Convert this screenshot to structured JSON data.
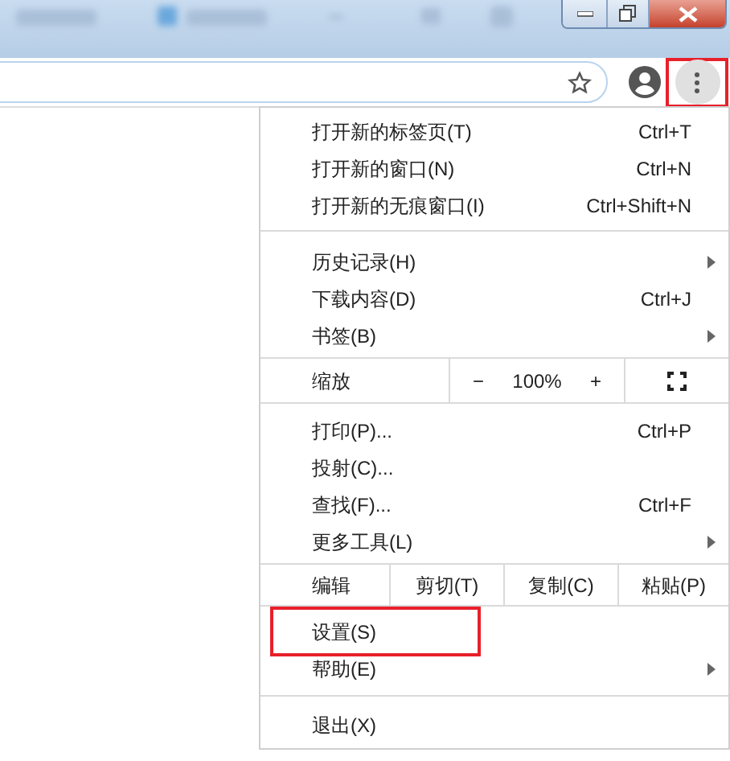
{
  "toolbar": {
    "menu_button_highlighted": true
  },
  "menu": {
    "sections": [
      {
        "items": [
          {
            "kind": "command",
            "label": "打开新的标签页(T)",
            "shortcut": "Ctrl+T",
            "submenu": false,
            "highlighted": false
          },
          {
            "kind": "command",
            "label": "打开新的窗口(N)",
            "shortcut": "Ctrl+N",
            "submenu": false,
            "highlighted": false
          },
          {
            "kind": "command",
            "label": "打开新的无痕窗口(I)",
            "shortcut": "Ctrl+Shift+N",
            "submenu": false,
            "highlighted": false
          }
        ]
      },
      {
        "items": [
          {
            "kind": "command",
            "label": "历史记录(H)",
            "submenu": true,
            "highlighted": false
          },
          {
            "kind": "command",
            "label": "下载内容(D)",
            "shortcut": "Ctrl+J",
            "submenu": false,
            "highlighted": false
          },
          {
            "kind": "command",
            "label": "书签(B)",
            "submenu": true,
            "highlighted": false
          }
        ]
      },
      {
        "items": [
          {
            "kind": "zoom",
            "label": "缩放",
            "minus": "−",
            "value": "100%",
            "plus": "+"
          }
        ]
      },
      {
        "items": [
          {
            "kind": "command",
            "label": "打印(P)...",
            "shortcut": "Ctrl+P",
            "submenu": false,
            "highlighted": false
          },
          {
            "kind": "command",
            "label": "投射(C)...",
            "submenu": false,
            "highlighted": false
          },
          {
            "kind": "command",
            "label": "查找(F)...",
            "shortcut": "Ctrl+F",
            "submenu": false,
            "highlighted": false
          },
          {
            "kind": "command",
            "label": "更多工具(L)",
            "submenu": true,
            "highlighted": false
          }
        ]
      },
      {
        "items": [
          {
            "kind": "edit",
            "label": "编辑",
            "cut": "剪切(T)",
            "copy": "复制(C)",
            "paste": "粘贴(P)"
          }
        ]
      },
      {
        "items": [
          {
            "kind": "command",
            "label": "设置(S)",
            "submenu": false,
            "highlighted": true
          },
          {
            "kind": "command",
            "label": "帮助(E)",
            "submenu": true,
            "highlighted": false
          }
        ]
      },
      {
        "items": [
          {
            "kind": "command",
            "label": "退出(X)",
            "submenu": false,
            "highlighted": false
          }
        ]
      }
    ]
  }
}
